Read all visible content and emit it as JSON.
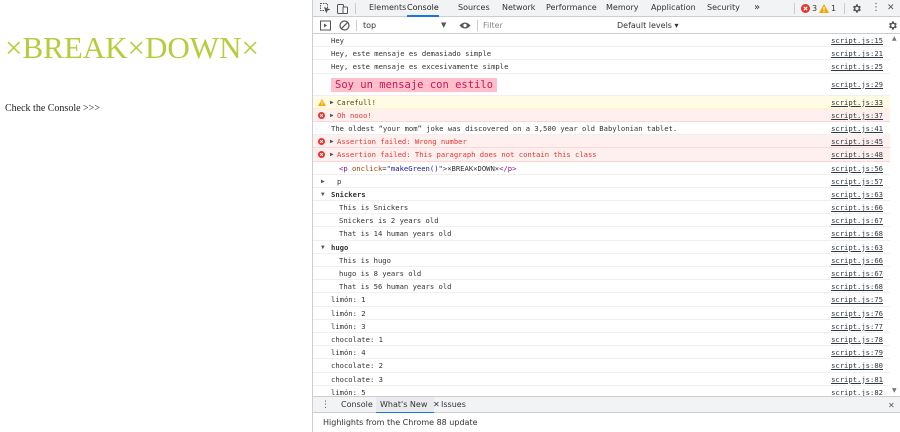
{
  "page": {
    "title": "×BREAK×DOWN×",
    "text": "Check the Console >>>"
  },
  "devtools": {
    "tabs": [
      "Elements",
      "Console",
      "Sources",
      "Network",
      "Performance",
      "Memory",
      "Application",
      "Security"
    ],
    "more_tabs": "»",
    "error_count": "3",
    "warning_count": "1",
    "menu_glyph": "⋮",
    "close_glyph": "✕",
    "context": "top",
    "dropdown_glyph": "▼",
    "filter_placeholder": "Filter",
    "levels_label": "Default levels ▾"
  },
  "console": {
    "rows": [
      {
        "type": "log",
        "text": "Hey",
        "src": "script.js:15"
      },
      {
        "type": "log",
        "text": "Hey, este mensaje es demasiado simple",
        "src": "script.js:21"
      },
      {
        "type": "log",
        "text": "Hey, este mensaje es excesivamente simple",
        "src": "script.js:25"
      },
      {
        "type": "styled",
        "text": "Soy un mensaje con estilo",
        "src": "script.js:29"
      },
      {
        "type": "warning",
        "text": "Carefull!",
        "src": "script.js:33"
      },
      {
        "type": "error",
        "text": "Oh nooo!",
        "src": "script.js:37"
      },
      {
        "type": "log",
        "text": "The oldest “your mom” joke was discovered on a 3,500 year old Babylonian tablet.",
        "src": "script.js:41"
      },
      {
        "type": "error",
        "text": "Assertion failed: Wrong number",
        "src": "script.js:45"
      },
      {
        "type": "error",
        "text": "Assertion failed: This paragraph does not contain this class",
        "src": "script.js:48"
      },
      {
        "type": "element",
        "tag_open": "<p",
        "attr_name": "onclick",
        "attr_value": "\"makeGreen()\"",
        "content": "×BREAK×DOWN×",
        "tag_close": "</p>",
        "src": "script.js:56"
      },
      {
        "type": "object",
        "text": "p",
        "src": "script.js:57"
      },
      {
        "type": "group",
        "text": "Snickers",
        "src": "script.js:63"
      },
      {
        "type": "nested",
        "text": "This is Snickers",
        "src": "script.js:66"
      },
      {
        "type": "nested",
        "text": "Snickers is 2 years old",
        "src": "script.js:67"
      },
      {
        "type": "nested",
        "text": "That is 14 human years old",
        "src": "script.js:68"
      },
      {
        "type": "group",
        "text": "hugo",
        "src": "script.js:63"
      },
      {
        "type": "nested",
        "text": "This is hugo",
        "src": "script.js:66"
      },
      {
        "type": "nested",
        "text": "hugo is 8 years old",
        "src": "script.js:67"
      },
      {
        "type": "nested",
        "text": "That is 56 human years old",
        "src": "script.js:68"
      },
      {
        "type": "log",
        "text": "limón: 1",
        "src": "script.js:75"
      },
      {
        "type": "log",
        "text": "limón: 2",
        "src": "script.js:76"
      },
      {
        "type": "log",
        "text": "limón: 3",
        "src": "script.js:77"
      },
      {
        "type": "log",
        "text": "chocolate: 1",
        "src": "script.js:78"
      },
      {
        "type": "log",
        "text": "limón: 4",
        "src": "script.js:79"
      },
      {
        "type": "log",
        "text": "chocolate: 2",
        "src": "script.js:80"
      },
      {
        "type": "log",
        "text": "chocolate: 3",
        "src": "script.js:81"
      },
      {
        "type": "log",
        "text": "limón: 5",
        "src": "script.js:82"
      }
    ]
  },
  "drawer": {
    "menu_glyph": "⋮",
    "tabs": [
      "Console",
      "What's New",
      "Issues"
    ],
    "active_tab_close": "✕",
    "close_glyph": "✕",
    "content": "Highlights from the Chrome 88 update"
  },
  "colors": {
    "title_green": "#b5cd3c",
    "accent_blue": "#1a73e8",
    "error_red": "#e8342f",
    "warning_yellow": "#f2a900",
    "styled_bg": "#ffc0cb",
    "styled_text": "#c2185b"
  },
  "icons": [
    "inspect-element-icon",
    "device-toolbar-icon",
    "error-circle-icon",
    "warning-triangle-icon",
    "gear-icon",
    "kebab-menu-icon",
    "close-icon",
    "sidebar-toggle-icon",
    "clear-console-icon",
    "eye-icon",
    "console-settings-gear-icon"
  ]
}
